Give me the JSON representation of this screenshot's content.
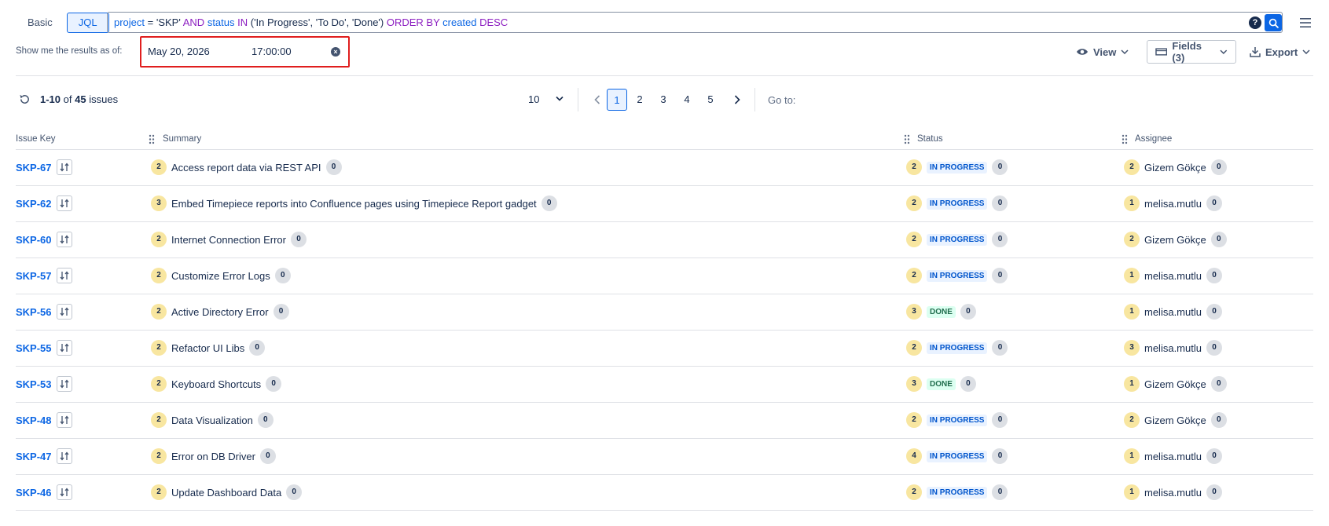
{
  "search_mode": {
    "basic_label": "Basic",
    "jql_label": "JQL",
    "active": "JQL"
  },
  "jql": {
    "tokens": [
      {
        "text": "project",
        "kind": "field"
      },
      {
        "text": " = ",
        "kind": "val"
      },
      {
        "text": "'SKP'",
        "kind": "val"
      },
      {
        "text": " AND ",
        "kind": "op"
      },
      {
        "text": "status",
        "kind": "field"
      },
      {
        "text": " IN ",
        "kind": "op"
      },
      {
        "text": "('In Progress', 'To Do', 'Done')",
        "kind": "val"
      },
      {
        "text": " ORDER BY ",
        "kind": "op"
      },
      {
        "text": "created",
        "kind": "field"
      },
      {
        "text": " DESC",
        "kind": "op"
      }
    ]
  },
  "as_of": {
    "label": "Show me the results as of:",
    "date": "May 20, 2026",
    "time": "17:00:00"
  },
  "toolbar": {
    "view_label": "View",
    "fields_label": "Fields (3)",
    "export_label": "Export"
  },
  "pagination": {
    "range": "1-10",
    "of_text": "of",
    "total": "45",
    "issues_text": "issues",
    "per_page": "10",
    "pages": [
      "1",
      "2",
      "3",
      "4",
      "5"
    ],
    "current_page": "1",
    "goto_label": "Go to:"
  },
  "columns": {
    "key": "Issue Key",
    "summary": "Summary",
    "status": "Status",
    "assignee": "Assignee"
  },
  "rows": [
    {
      "key": "SKP-67",
      "sum_n": "2",
      "summary": "Access report data via REST API",
      "sum_c": "0",
      "st_n": "2",
      "status": "IN PROGRESS",
      "st_c": "0",
      "as_n": "2",
      "assignee": "Gizem Gökçe",
      "as_c": "0"
    },
    {
      "key": "SKP-62",
      "sum_n": "3",
      "summary": "Embed Timepiece reports into Confluence pages using Timepiece Report gadget",
      "sum_c": "0",
      "st_n": "2",
      "status": "IN PROGRESS",
      "st_c": "0",
      "as_n": "1",
      "assignee": "melisa.mutlu",
      "as_c": "0"
    },
    {
      "key": "SKP-60",
      "sum_n": "2",
      "summary": "Internet Connection Error",
      "sum_c": "0",
      "st_n": "2",
      "status": "IN PROGRESS",
      "st_c": "0",
      "as_n": "2",
      "assignee": "Gizem Gökçe",
      "as_c": "0"
    },
    {
      "key": "SKP-57",
      "sum_n": "2",
      "summary": "Customize Error Logs",
      "sum_c": "0",
      "st_n": "2",
      "status": "IN PROGRESS",
      "st_c": "0",
      "as_n": "1",
      "assignee": "melisa.mutlu",
      "as_c": "0"
    },
    {
      "key": "SKP-56",
      "sum_n": "2",
      "summary": "Active Directory Error",
      "sum_c": "0",
      "st_n": "3",
      "status": "DONE",
      "st_c": "0",
      "as_n": "1",
      "assignee": "melisa.mutlu",
      "as_c": "0"
    },
    {
      "key": "SKP-55",
      "sum_n": "2",
      "summary": "Refactor UI Libs",
      "sum_c": "0",
      "st_n": "2",
      "status": "IN PROGRESS",
      "st_c": "0",
      "as_n": "3",
      "assignee": "melisa.mutlu",
      "as_c": "0"
    },
    {
      "key": "SKP-53",
      "sum_n": "2",
      "summary": "Keyboard Shortcuts",
      "sum_c": "0",
      "st_n": "3",
      "status": "DONE",
      "st_c": "0",
      "as_n": "1",
      "assignee": "Gizem Gökçe",
      "as_c": "0"
    },
    {
      "key": "SKP-48",
      "sum_n": "2",
      "summary": "Data Visualization",
      "sum_c": "0",
      "st_n": "2",
      "status": "IN PROGRESS",
      "st_c": "0",
      "as_n": "2",
      "assignee": "Gizem Gökçe",
      "as_c": "0"
    },
    {
      "key": "SKP-47",
      "sum_n": "2",
      "summary": "Error on DB Driver",
      "sum_c": "0",
      "st_n": "4",
      "status": "IN PROGRESS",
      "st_c": "0",
      "as_n": "1",
      "assignee": "melisa.mutlu",
      "as_c": "0"
    },
    {
      "key": "SKP-46",
      "sum_n": "2",
      "summary": "Update Dashboard Data",
      "sum_c": "0",
      "st_n": "2",
      "status": "IN PROGRESS",
      "st_c": "0",
      "as_n": "1",
      "assignee": "melisa.mutlu",
      "as_c": "0"
    }
  ],
  "colors": {
    "accent": "#0c66e4",
    "highlight_border": "#e01e1e",
    "count_badge": "#f8e6a0"
  }
}
